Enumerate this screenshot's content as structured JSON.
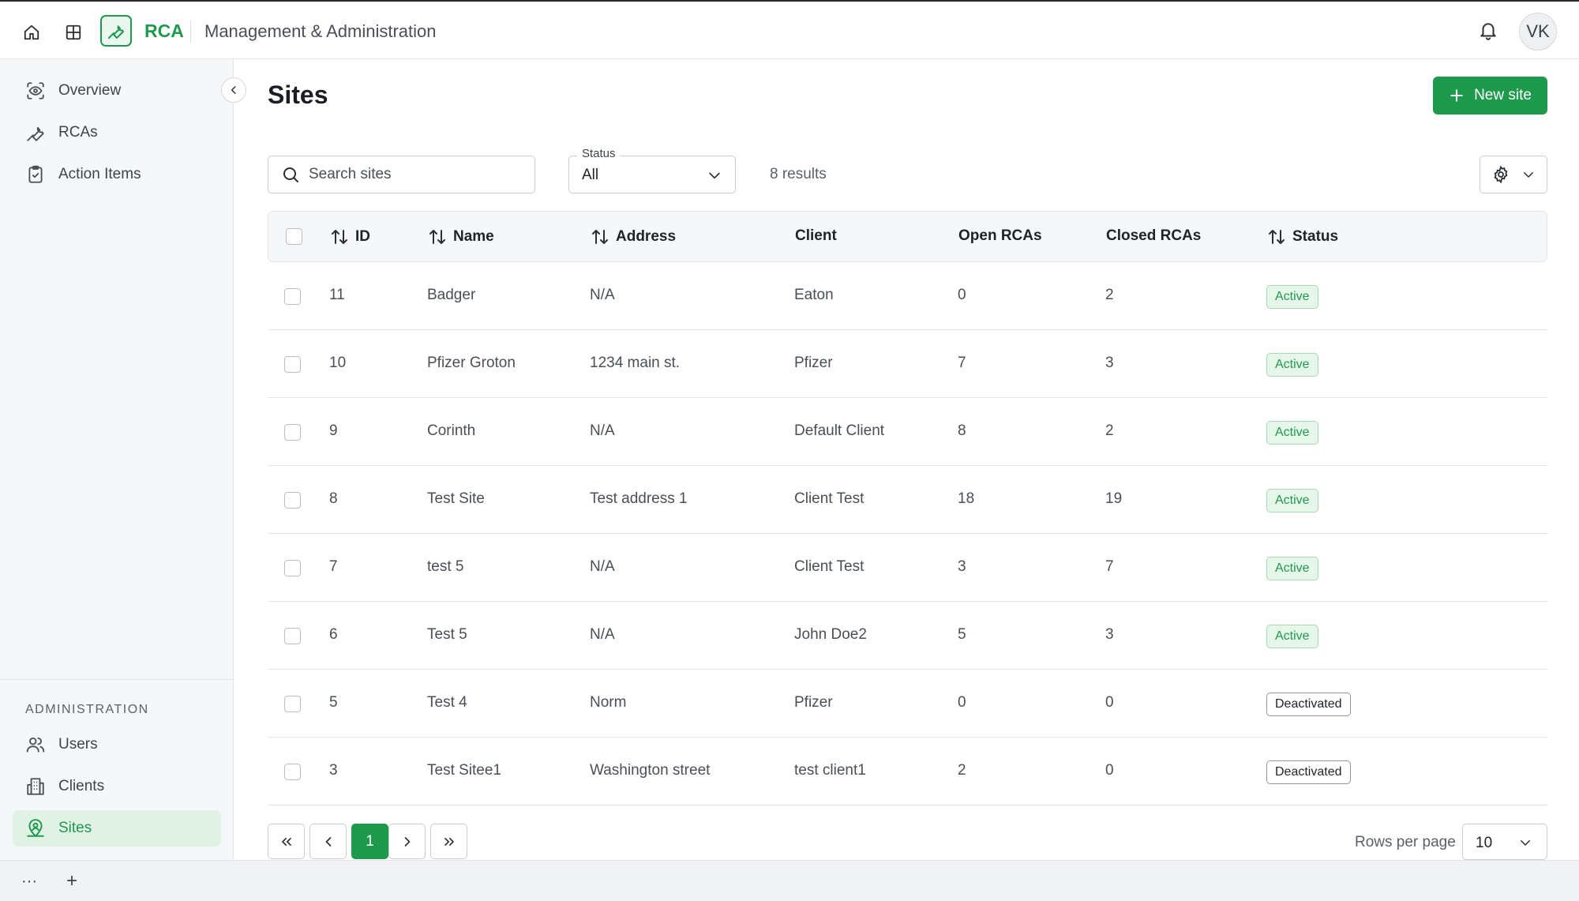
{
  "header": {
    "app_name": "RCA",
    "section": "Management & Administration",
    "user_initials": "VK",
    "icons": [
      "home-icon",
      "grid-icon",
      "wrench-icon",
      "bell-icon"
    ]
  },
  "sidebar": {
    "main_items": [
      {
        "label": "Overview",
        "icon": "overview-icon"
      },
      {
        "label": "RCAs",
        "icon": "wrench-icon"
      },
      {
        "label": "Action Items",
        "icon": "clipboard-check-icon"
      }
    ],
    "admin_heading": "ADMINISTRATION",
    "admin_items": [
      {
        "label": "Users",
        "icon": "users-icon"
      },
      {
        "label": "Clients",
        "icon": "building-icon"
      },
      {
        "label": "Sites",
        "icon": "map-pin-user-icon",
        "active": true
      }
    ]
  },
  "page": {
    "title": "Sites",
    "new_button_label": "New site"
  },
  "filters": {
    "search_placeholder": "Search sites",
    "search_value": "",
    "status_label": "Status",
    "status_value": "All",
    "results_text": "8 results"
  },
  "table": {
    "columns": {
      "id": "ID",
      "name": "Name",
      "address": "Address",
      "client": "Client",
      "open_rcas": "Open RCAs",
      "closed_rcas": "Closed RCAs",
      "status": "Status"
    },
    "rows": [
      {
        "id": "11",
        "name": "Badger",
        "address": "N/A",
        "client": "Eaton",
        "open": "0",
        "closed": "2",
        "status": "Active"
      },
      {
        "id": "10",
        "name": "Pfizer Groton",
        "address": "1234 main st.",
        "client": "Pfizer",
        "open": "7",
        "closed": "3",
        "status": "Active"
      },
      {
        "id": "9",
        "name": "Corinth",
        "address": "N/A",
        "client": "Default Client",
        "open": "8",
        "closed": "2",
        "status": "Active"
      },
      {
        "id": "8",
        "name": "Test Site",
        "address": "Test address 1",
        "client": "Client Test",
        "open": "18",
        "closed": "19",
        "status": "Active"
      },
      {
        "id": "7",
        "name": "test 5",
        "address": "N/A",
        "client": "Client Test",
        "open": "3",
        "closed": "7",
        "status": "Active"
      },
      {
        "id": "6",
        "name": "Test 5",
        "address": "N/A",
        "client": "John Doe2",
        "open": "5",
        "closed": "3",
        "status": "Active"
      },
      {
        "id": "5",
        "name": "Test 4",
        "address": "Norm",
        "client": "Pfizer",
        "open": "0",
        "closed": "0",
        "status": "Deactivated"
      },
      {
        "id": "3",
        "name": "Test Sitee1",
        "address": "Washington street",
        "client": "test client1",
        "open": "2",
        "closed": "0",
        "status": "Deactivated"
      }
    ]
  },
  "pagination": {
    "current_page": "1",
    "rows_per_page_label": "Rows per page",
    "rows_per_page_value": "10"
  },
  "bottombar": {
    "more_label": "···",
    "add_label": "+"
  },
  "colors": {
    "accent": "#1e9a4c",
    "accent_light": "#e1f1e6",
    "border": "#e3e5e8"
  }
}
